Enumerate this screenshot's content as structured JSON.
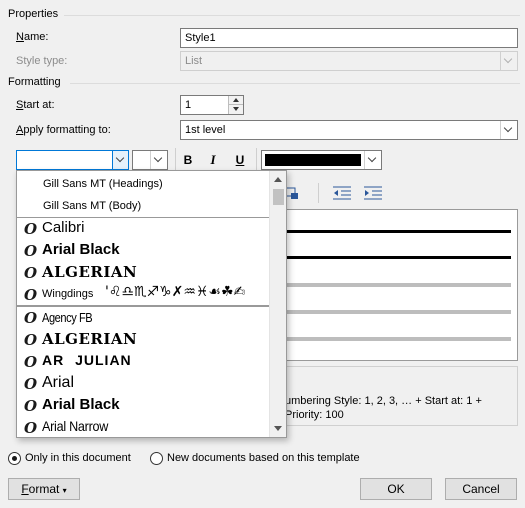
{
  "properties": {
    "section_title": "Properties",
    "name_label": "Name:",
    "name_value": "Style1",
    "style_type_label": "Style type:",
    "style_type_value": "List"
  },
  "formatting": {
    "section_title": "Formatting",
    "start_at_label": "Start at:",
    "start_at_value": "1",
    "apply_to_label": "Apply formatting to:",
    "apply_to_value": "1st level",
    "bold": "B",
    "italic": "I",
    "underline": "U",
    "font_color": "#000000"
  },
  "font_dropdown": {
    "theme_fonts": [
      "Gill Sans MT (Headings)",
      "Gill Sans MT (Body)"
    ],
    "recent_fonts": [
      "Calibri",
      "Arial Black",
      "ALGERIAN",
      "Wingdings"
    ],
    "wingdings_sample": "'♌♎♏♐♑✗♒♓☙☘✍",
    "all_fonts": [
      "Agency FB",
      "ALGERIAN",
      "AR JULIAN",
      "Arial",
      "Arial Black",
      "Arial Narrow"
    ],
    "glyph": "O"
  },
  "description": {
    "line1": "umbering Style: 1, 2, 3, … + Start at: 1 +",
    "line2": "Priority: 100"
  },
  "options": {
    "only_this_doc": "Only in this document",
    "new_docs": "New documents based on this template",
    "selected": "only_this_doc"
  },
  "buttons": {
    "format": "Format",
    "ok": "OK",
    "cancel": "Cancel"
  }
}
